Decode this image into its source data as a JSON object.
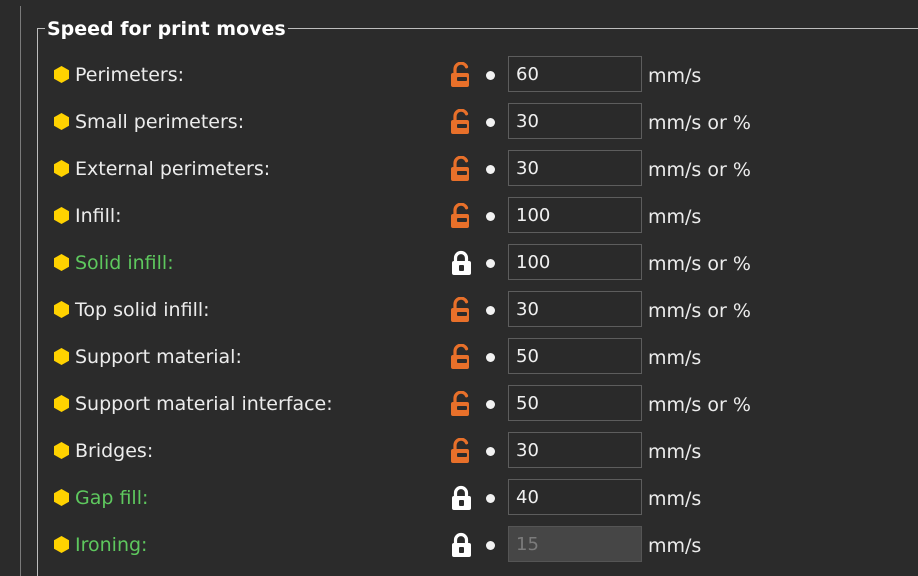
{
  "group": {
    "title": "Speed for print moves"
  },
  "colors": {
    "background": "#2b2b2b",
    "user_value_lock": "#e8702a",
    "system_value_lock": "#ffffff",
    "system_label": "#5ec85e",
    "mode_hexagon": "#ffd200"
  },
  "rows": [
    {
      "label": "Perimeters:",
      "value": "60",
      "unit": "mm/s",
      "lock": "unlocked-lock-icon",
      "system": false,
      "disabled": false
    },
    {
      "label": "Small perimeters:",
      "value": "30",
      "unit": "mm/s or %",
      "lock": "unlocked-lock-icon",
      "system": false,
      "disabled": false
    },
    {
      "label": "External perimeters:",
      "value": "30",
      "unit": "mm/s or %",
      "lock": "unlocked-lock-icon",
      "system": false,
      "disabled": false
    },
    {
      "label": "Infill:",
      "value": "100",
      "unit": "mm/s",
      "lock": "unlocked-lock-icon",
      "system": false,
      "disabled": false
    },
    {
      "label": "Solid infill:",
      "value": "100",
      "unit": "mm/s or %",
      "lock": "locked-lock-icon",
      "system": true,
      "disabled": false
    },
    {
      "label": "Top solid infill:",
      "value": "30",
      "unit": "mm/s or %",
      "lock": "unlocked-lock-icon",
      "system": false,
      "disabled": false
    },
    {
      "label": "Support material:",
      "value": "50",
      "unit": "mm/s",
      "lock": "unlocked-lock-icon",
      "system": false,
      "disabled": false
    },
    {
      "label": "Support material interface:",
      "value": "50",
      "unit": "mm/s or %",
      "lock": "unlocked-lock-icon",
      "system": false,
      "disabled": false
    },
    {
      "label": "Bridges:",
      "value": "30",
      "unit": "mm/s",
      "lock": "unlocked-lock-icon",
      "system": false,
      "disabled": false
    },
    {
      "label": "Gap fill:",
      "value": "40",
      "unit": "mm/s",
      "lock": "locked-lock-icon",
      "system": true,
      "disabled": false
    },
    {
      "label": "Ironing:",
      "value": "15",
      "unit": "mm/s",
      "lock": "locked-lock-icon",
      "system": true,
      "disabled": true
    }
  ]
}
